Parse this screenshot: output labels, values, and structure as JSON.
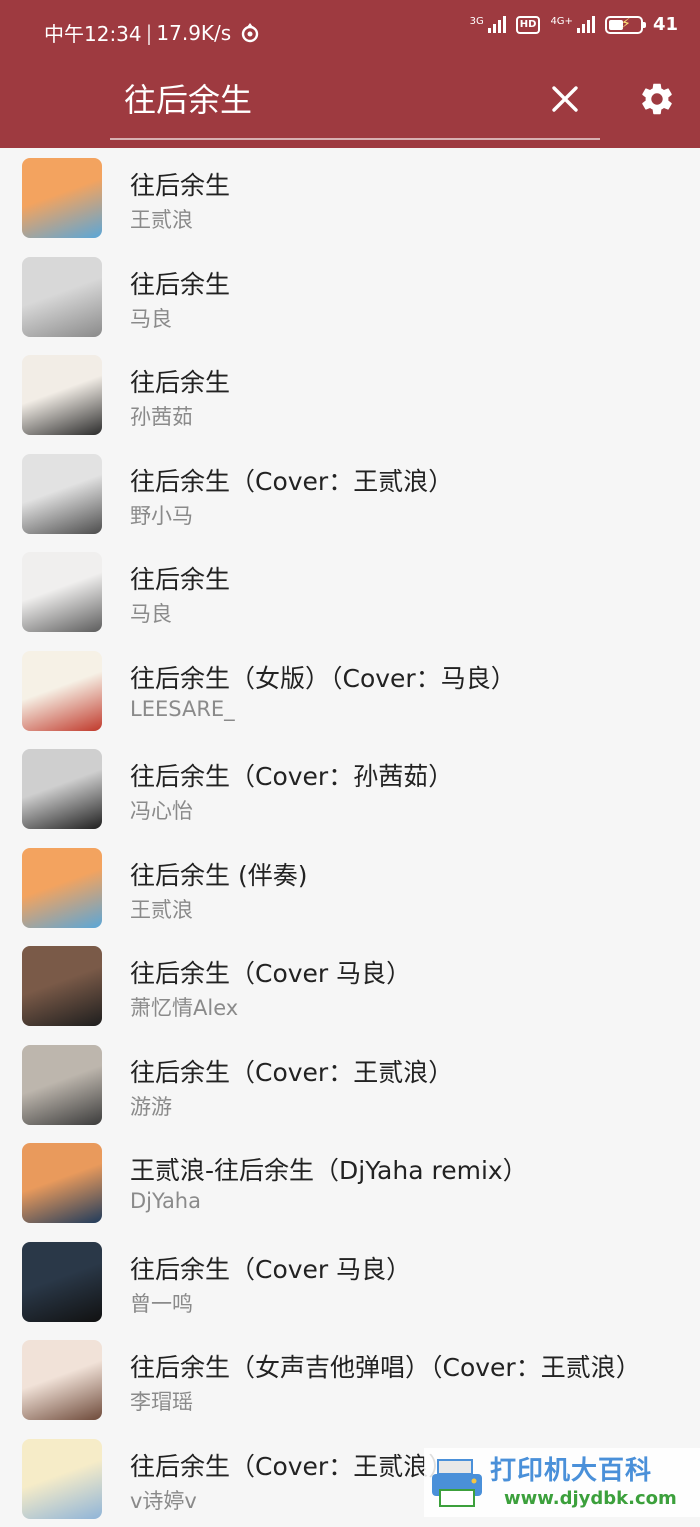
{
  "status_bar": {
    "time": "中午12:34",
    "net_speed": "17.9K/s",
    "signal1_label": "3G",
    "hd_label": "HD",
    "signal2_label": "4G+",
    "battery_percent": "41"
  },
  "search": {
    "query": "往后余生"
  },
  "colors": {
    "header": "#9e3a40",
    "background": "#f6f6f6"
  },
  "songs": [
    {
      "title": "往后余生",
      "artist": "王贰浪",
      "thumb": [
        "#f3a35f",
        "#5aa6d8"
      ]
    },
    {
      "title": "往后余生",
      "artist": "马良",
      "thumb": [
        "#d8d8d8",
        "#8a8a8a"
      ]
    },
    {
      "title": "往后余生",
      "artist": "孙茜茹",
      "thumb": [
        "#f2ede6",
        "#2b2b2b"
      ]
    },
    {
      "title": "往后余生（Cover：王贰浪）",
      "artist": "野小马",
      "thumb": [
        "#e2e2e2",
        "#4c4c4c"
      ]
    },
    {
      "title": "往后余生",
      "artist": "马良",
      "thumb": [
        "#f0efee",
        "#5c5c5c"
      ]
    },
    {
      "title": "往后余生（女版）（Cover：马良）",
      "artist": "LEESARE_",
      "thumb": [
        "#f6f1e6",
        "#c0392b"
      ]
    },
    {
      "title": "往后余生（Cover：孙茜茹）",
      "artist": "冯心怡",
      "thumb": [
        "#cfcfcf",
        "#1f1f1f"
      ]
    },
    {
      "title": "往后余生 (伴奏)",
      "artist": "王贰浪",
      "thumb": [
        "#f3a35f",
        "#5aa6d8"
      ]
    },
    {
      "title": "往后余生（Cover 马良）",
      "artist": "萧忆情Alex",
      "thumb": [
        "#7a5a48",
        "#1e1e1e"
      ]
    },
    {
      "title": "往后余生（Cover：王贰浪）",
      "artist": "游游",
      "thumb": [
        "#bdb6ad",
        "#3b3b3b"
      ]
    },
    {
      "title": "王贰浪-往后余生（DjYaha remix）",
      "artist": "DjYaha",
      "thumb": [
        "#e99a5c",
        "#1f3b5c"
      ]
    },
    {
      "title": "往后余生（Cover 马良）",
      "artist": "曾一鸣",
      "thumb": [
        "#2a3848",
        "#111111"
      ]
    },
    {
      "title": "往后余生（女声吉他弹唱）（Cover：王贰浪）",
      "artist": "李瑁瑶",
      "thumb": [
        "#f1e2d8",
        "#6e4a3a"
      ]
    },
    {
      "title": "往后余生（Cover：王贰浪）",
      "artist": "v诗婷v",
      "thumb": [
        "#f6ecc8",
        "#8fb4d8"
      ]
    }
  ],
  "watermark": {
    "text": "打印机大百科",
    "url": "www.djydbk.com"
  }
}
